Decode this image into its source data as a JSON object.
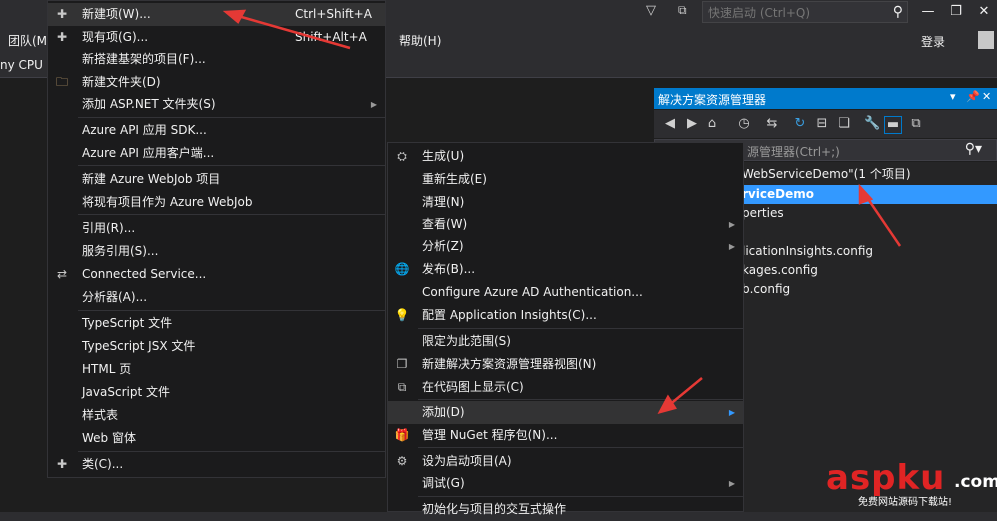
{
  "titlebar": {
    "quick_launch_placeholder": "快速启动 (Ctrl+Q)",
    "login": "登录"
  },
  "menubar": {
    "team_partial": "团队(M",
    "help": "帮助(H)",
    "cpu_partial": "ny CPU"
  },
  "solution_explorer": {
    "title": "解决方案资源管理器",
    "search_placeholder": "源管理器(Ctrl+;)",
    "tree": [
      {
        "label": "WebServiceDemo\"(1 个项目)",
        "selected": false
      },
      {
        "label": "rviceDemo",
        "selected": true
      },
      {
        "label": "perties",
        "selected": false
      },
      {
        "label": "",
        "selected": false
      },
      {
        "label": "licationInsights.config",
        "selected": false
      },
      {
        "label": "kages.config",
        "selected": false
      },
      {
        "label": "b.config",
        "selected": false
      }
    ]
  },
  "add_submenu": {
    "items": [
      {
        "label": "新建项(W)...",
        "shortcut": "Ctrl+Shift+A",
        "icon": "new-item-icon",
        "highlight": true
      },
      {
        "label": "现有项(G)...",
        "shortcut": "Shift+Alt+A",
        "icon": "existing-item-icon"
      },
      {
        "label": "新搭建基架的项目(F)...",
        "shortcut": ""
      },
      {
        "label": "新建文件夹(D)",
        "shortcut": "",
        "icon": "folder-icon"
      },
      {
        "label": "添加 ASP.NET 文件夹(S)",
        "shortcut": "",
        "submenu": true
      },
      {
        "label": "Azure API 应用 SDK...",
        "shortcut": ""
      },
      {
        "label": "Azure API 应用客户端...",
        "shortcut": ""
      },
      {
        "label": "新建 Azure WebJob 项目",
        "shortcut": ""
      },
      {
        "label": "将现有项目作为 Azure WebJob",
        "shortcut": ""
      },
      {
        "label": "引用(R)...",
        "shortcut": ""
      },
      {
        "label": "服务引用(S)...",
        "shortcut": ""
      },
      {
        "label": "Connected Service...",
        "shortcut": "",
        "icon": "connected-service-icon"
      },
      {
        "label": "分析器(A)...",
        "shortcut": ""
      },
      {
        "label": "TypeScript 文件",
        "shortcut": ""
      },
      {
        "label": "TypeScript JSX 文件",
        "shortcut": ""
      },
      {
        "label": "HTML 页",
        "shortcut": ""
      },
      {
        "label": "JavaScript 文件",
        "shortcut": ""
      },
      {
        "label": "样式表",
        "shortcut": ""
      },
      {
        "label": "Web 窗体",
        "shortcut": ""
      },
      {
        "label": "类(C)...",
        "shortcut": "",
        "icon": "class-icon"
      }
    ]
  },
  "project_menu": {
    "items": [
      {
        "label": "生成(U)",
        "icon": "build-icon"
      },
      {
        "label": "重新生成(E)"
      },
      {
        "label": "清理(N)"
      },
      {
        "label": "查看(W)",
        "submenu": true
      },
      {
        "label": "分析(Z)",
        "submenu": true
      },
      {
        "label": "发布(B)...",
        "icon": "publish-icon"
      },
      {
        "label": "Configure Azure AD Authentication..."
      },
      {
        "label": "配置 Application Insights(C)...",
        "icon": "app-insights-icon"
      },
      {
        "label": "限定为此范围(S)"
      },
      {
        "label": "新建解决方案资源管理器视图(N)",
        "icon": "new-view-icon"
      },
      {
        "label": "在代码图上显示(C)",
        "icon": "code-map-icon"
      },
      {
        "label": "添加(D)",
        "submenu": true,
        "highlight": true
      },
      {
        "label": "管理 NuGet 程序包(N)...",
        "icon": "nuget-icon"
      },
      {
        "label": "设为启动项目(A)",
        "icon": "gear-icon"
      },
      {
        "label": "调试(G)",
        "submenu": true
      },
      {
        "label": "初始化与项目的交互式操作"
      }
    ]
  },
  "watermark": {
    "brand": "aspku",
    "tld": ".com",
    "tagline": "免费网站源码下载站!"
  },
  "colors": {
    "accent": "#007acc",
    "selection": "#3399ff",
    "menu_bg": "#1b1b1c",
    "annotation_arrow": "#e53935"
  }
}
